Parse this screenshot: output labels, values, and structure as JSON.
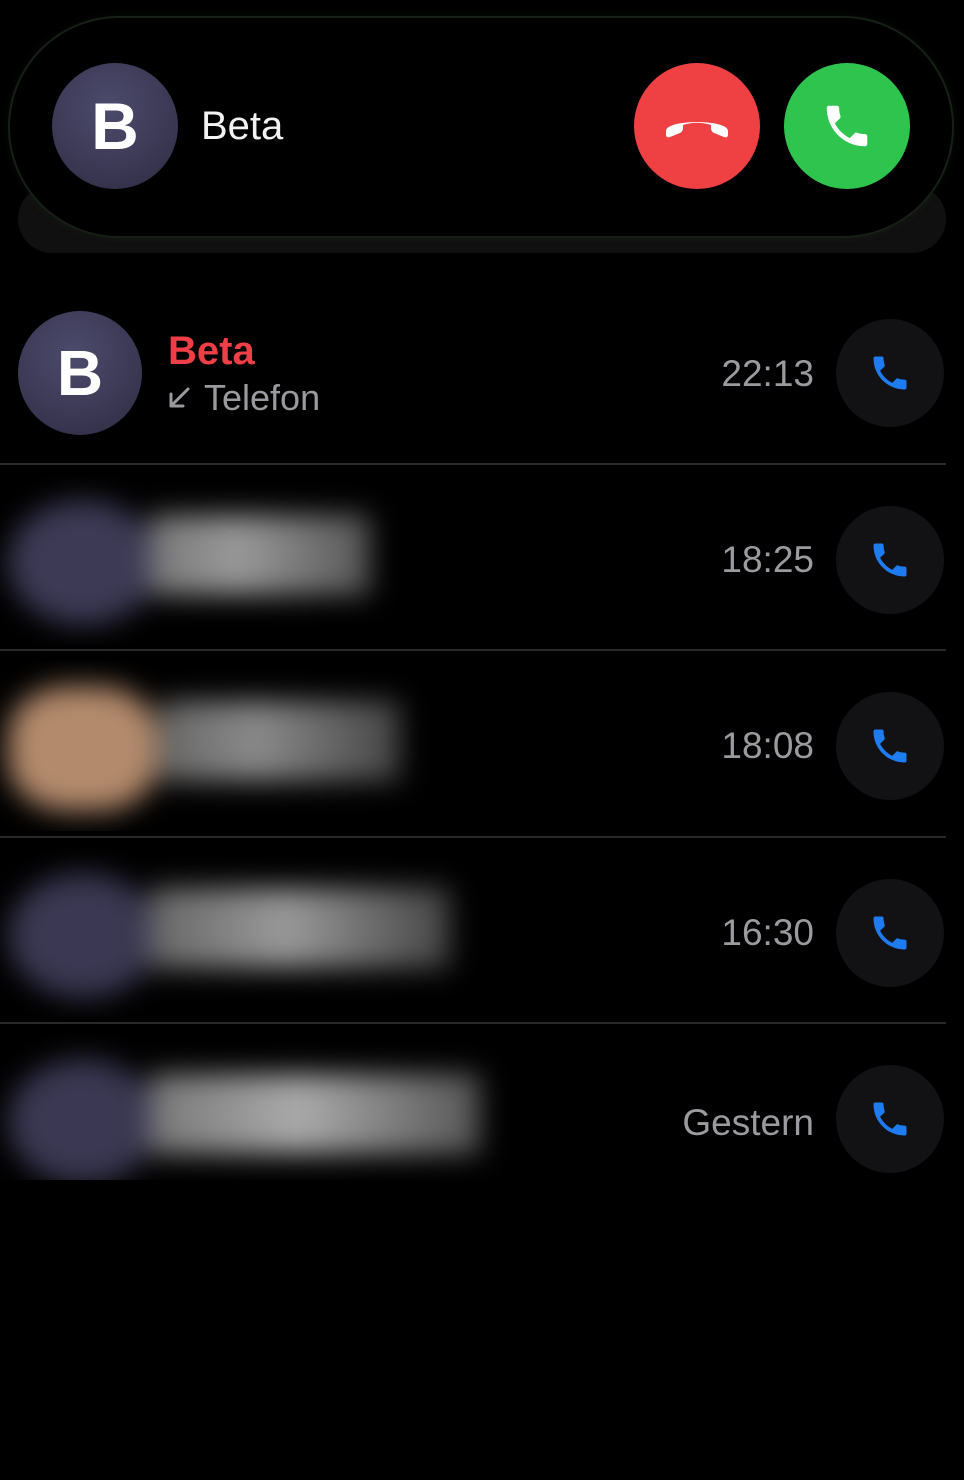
{
  "incoming_call": {
    "avatar_initial": "B",
    "caller_name": "Beta",
    "decline_icon": "phone-hangup-icon",
    "accept_icon": "phone-icon",
    "colors": {
      "decline": "#ef4043",
      "accept": "#2ec44e"
    }
  },
  "recents": [
    {
      "avatar_initial": "B",
      "name": "Beta",
      "direction_icon": "incoming-arrow-icon",
      "type": "Telefon",
      "time": "22:13",
      "missed": true
    },
    {
      "time": "18:25"
    },
    {
      "time": "18:08"
    },
    {
      "time": "16:30"
    },
    {
      "time": "Gestern"
    }
  ],
  "call_icon": "phone-icon",
  "accent_color": "#1e7bf0"
}
